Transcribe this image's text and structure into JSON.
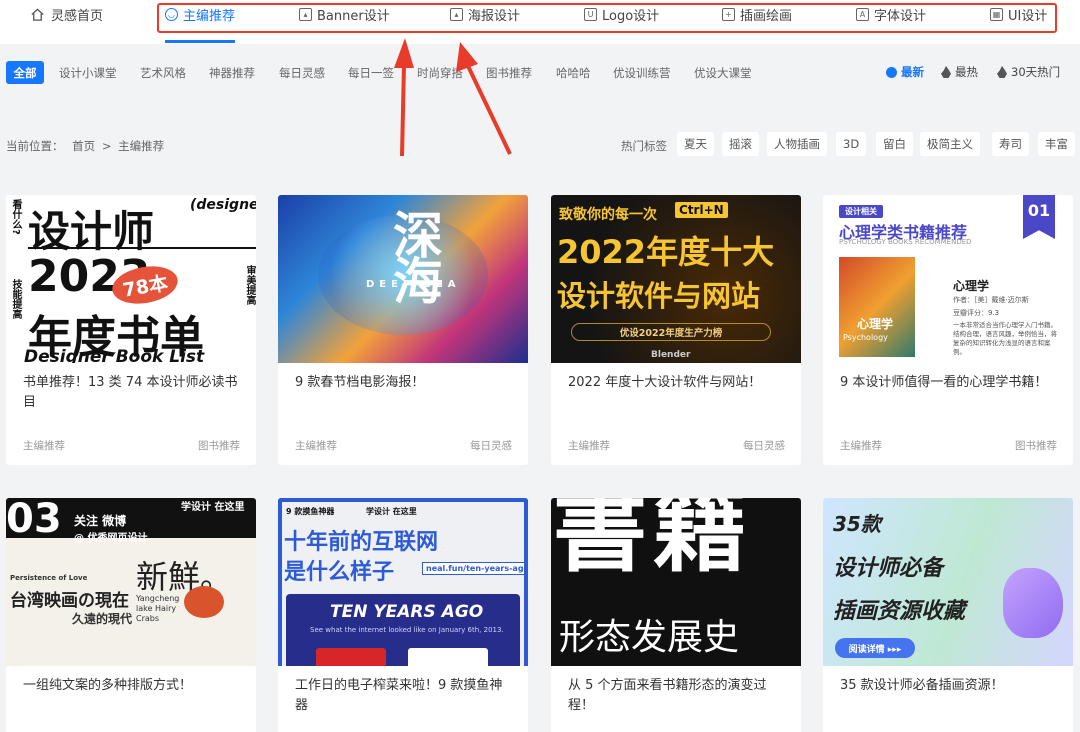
{
  "nav": {
    "home": "灵感首页",
    "tabs": [
      {
        "label": "主编推荐",
        "icon": "smile-icon"
      },
      {
        "label": "Banner设计",
        "icon": "image-icon"
      },
      {
        "label": "海报设计",
        "icon": "poster-icon"
      },
      {
        "label": "Logo设计",
        "icon": "logo-icon"
      },
      {
        "label": "插画绘画",
        "icon": "brush-icon"
      },
      {
        "label": "字体设计",
        "icon": "font-icon"
      },
      {
        "label": "UI设计",
        "icon": "layout-icon"
      }
    ]
  },
  "filters": {
    "all": "全部",
    "categories": [
      "设计小课堂",
      "艺术风格",
      "神器推荐",
      "每日灵感",
      "每日一签",
      "时尚穿搭",
      "图书推荐",
      "哈哈哈",
      "优设训练营",
      "优设大课堂"
    ],
    "sort": [
      "最新",
      "最热",
      "30天热门"
    ]
  },
  "breadcrumb": {
    "prefix": "当前位置：",
    "home": "首页",
    "sep": ">",
    "current": "主编推荐"
  },
  "hot_tags": {
    "label": "热门标签",
    "tags": [
      "夏天",
      "摇滚",
      "人物插画",
      "3D",
      "留白",
      "极简主义",
      "寿司",
      "丰富"
    ]
  },
  "cards": [
    {
      "title": "书单推荐！13 类 74 本设计师必读书目",
      "left_tag": "主编推荐",
      "right_tag": "图书推荐",
      "thumb": {
        "l1": "设计师",
        "l2": "2023",
        "l3": "年度书单",
        "l4": "Designer Book List",
        "badge": "78本",
        "corner": "(designer)",
        "side_left": "看什么?",
        "side_right": "审美提高",
        "side_left2": "技能提高"
      }
    },
    {
      "title": "9 款春节档电影海报！",
      "left_tag": "主编推荐",
      "right_tag": "每日灵感",
      "thumb": {
        "l1": "深海",
        "l2": "DEEP SEA"
      }
    },
    {
      "title": "2022 年度十大设计软件与网站！",
      "left_tag": "主编推荐",
      "right_tag": "每日灵感",
      "thumb": {
        "l1": "致敬你的每一次",
        "key": "Ctrl+N",
        "l2": "2022年度十大",
        "l3": "设计软件与网站",
        "l4": "优设2022年度生产力榜",
        "l5": "Blender"
      }
    },
    {
      "title": "9 本设计师值得一看的心理学书籍！",
      "left_tag": "主编推荐",
      "right_tag": "图书推荐",
      "thumb": {
        "badge": "设计相关",
        "l1": "心理学类书籍推荐",
        "l2": "PSYCHOLOGY BOOKS RECOMMENDED",
        "num": "01",
        "book": "心理学",
        "author": "作者：［美］戴维·迈尔斯",
        "score": "豆瓣评分：9.3",
        "desc": "一本非常适合当作心理学入门书籍。结构合理，语言风趣，举例恰当，将复杂的知识转化为浅显的语言和案例。",
        "cover": "心理学",
        "cover_en": "Psychology"
      }
    },
    {
      "title": "一组纯文案的多种排版方式！",
      "left_tag": "",
      "right_tag": "",
      "thumb": {
        "num": "03",
        "l1": "关注 微博",
        "l2": "@ 优秀网页设计",
        "l3": "学设计 在这里",
        "l4": "新鮮。",
        "l5": "台湾映画の現在",
        "l6": "Yangcheng lake Hairy Crabs",
        "l7": "Persistence of Love",
        "l8": "久遠的現代"
      }
    },
    {
      "title": "工作日的电子榨菜来啦！9 款摸鱼神器",
      "left_tag": "",
      "right_tag": "",
      "thumb": {
        "l0": "9 款摸鱼神器",
        "l0b": "学设计 在这里",
        "l1": "十年前的互联网",
        "l2": "是什么样子",
        "url": "neal.fun/ten-years-ago",
        "l3": "TEN YEARS AGO",
        "l4": "See what the internet looked like on January 6th, 2013."
      }
    },
    {
      "title": "从 5 个方面来看书籍形态的演变过程！",
      "left_tag": "",
      "right_tag": "",
      "thumb": {
        "l1": "書籍",
        "l2": "形态发展史"
      }
    },
    {
      "title": "35 款设计师必备插画资源！",
      "left_tag": "",
      "right_tag": "",
      "thumb": {
        "l1": "35款",
        "l2": "设计师必备",
        "l3": "插画资源收藏",
        "btn": "阅读详情 ▸▸▸"
      }
    }
  ],
  "colors": {
    "accent": "#1677ff",
    "annotation": "#e83b2a"
  }
}
